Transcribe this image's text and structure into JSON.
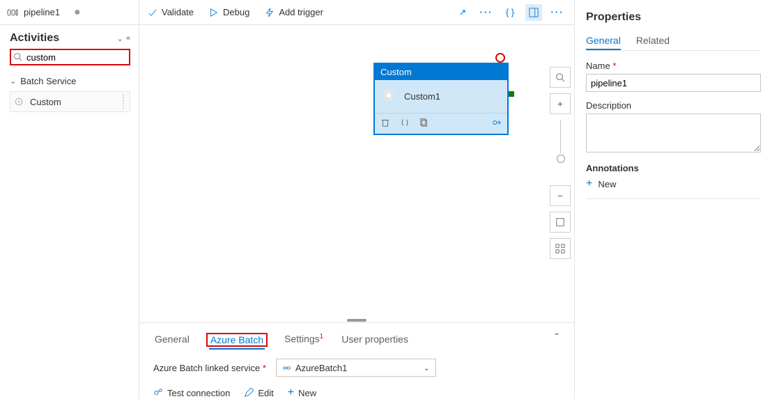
{
  "tab_title": "pipeline1",
  "activities": {
    "heading": "Activities",
    "search_value": "custom",
    "group_label": "Batch Service",
    "item_label": "Custom"
  },
  "toolbar": {
    "validate": "Validate",
    "debug": "Debug",
    "add_trigger": "Add trigger"
  },
  "canvas": {
    "node_title": "Custom",
    "node_label": "Custom1"
  },
  "bottom": {
    "tabs": {
      "general": "General",
      "azure_batch": "Azure Batch",
      "settings": "Settings",
      "settings_badge": "1",
      "user_props": "User properties"
    },
    "linked_service_label": "Azure Batch linked service",
    "linked_service_value": "AzureBatch1",
    "actions": {
      "test": "Test connection",
      "edit": "Edit",
      "new": "New"
    }
  },
  "props": {
    "heading": "Properties",
    "tabs": {
      "general": "General",
      "related": "Related"
    },
    "name_label": "Name",
    "name_value": "pipeline1",
    "desc_label": "Description",
    "ann_label": "Annotations",
    "new_label": "New"
  }
}
